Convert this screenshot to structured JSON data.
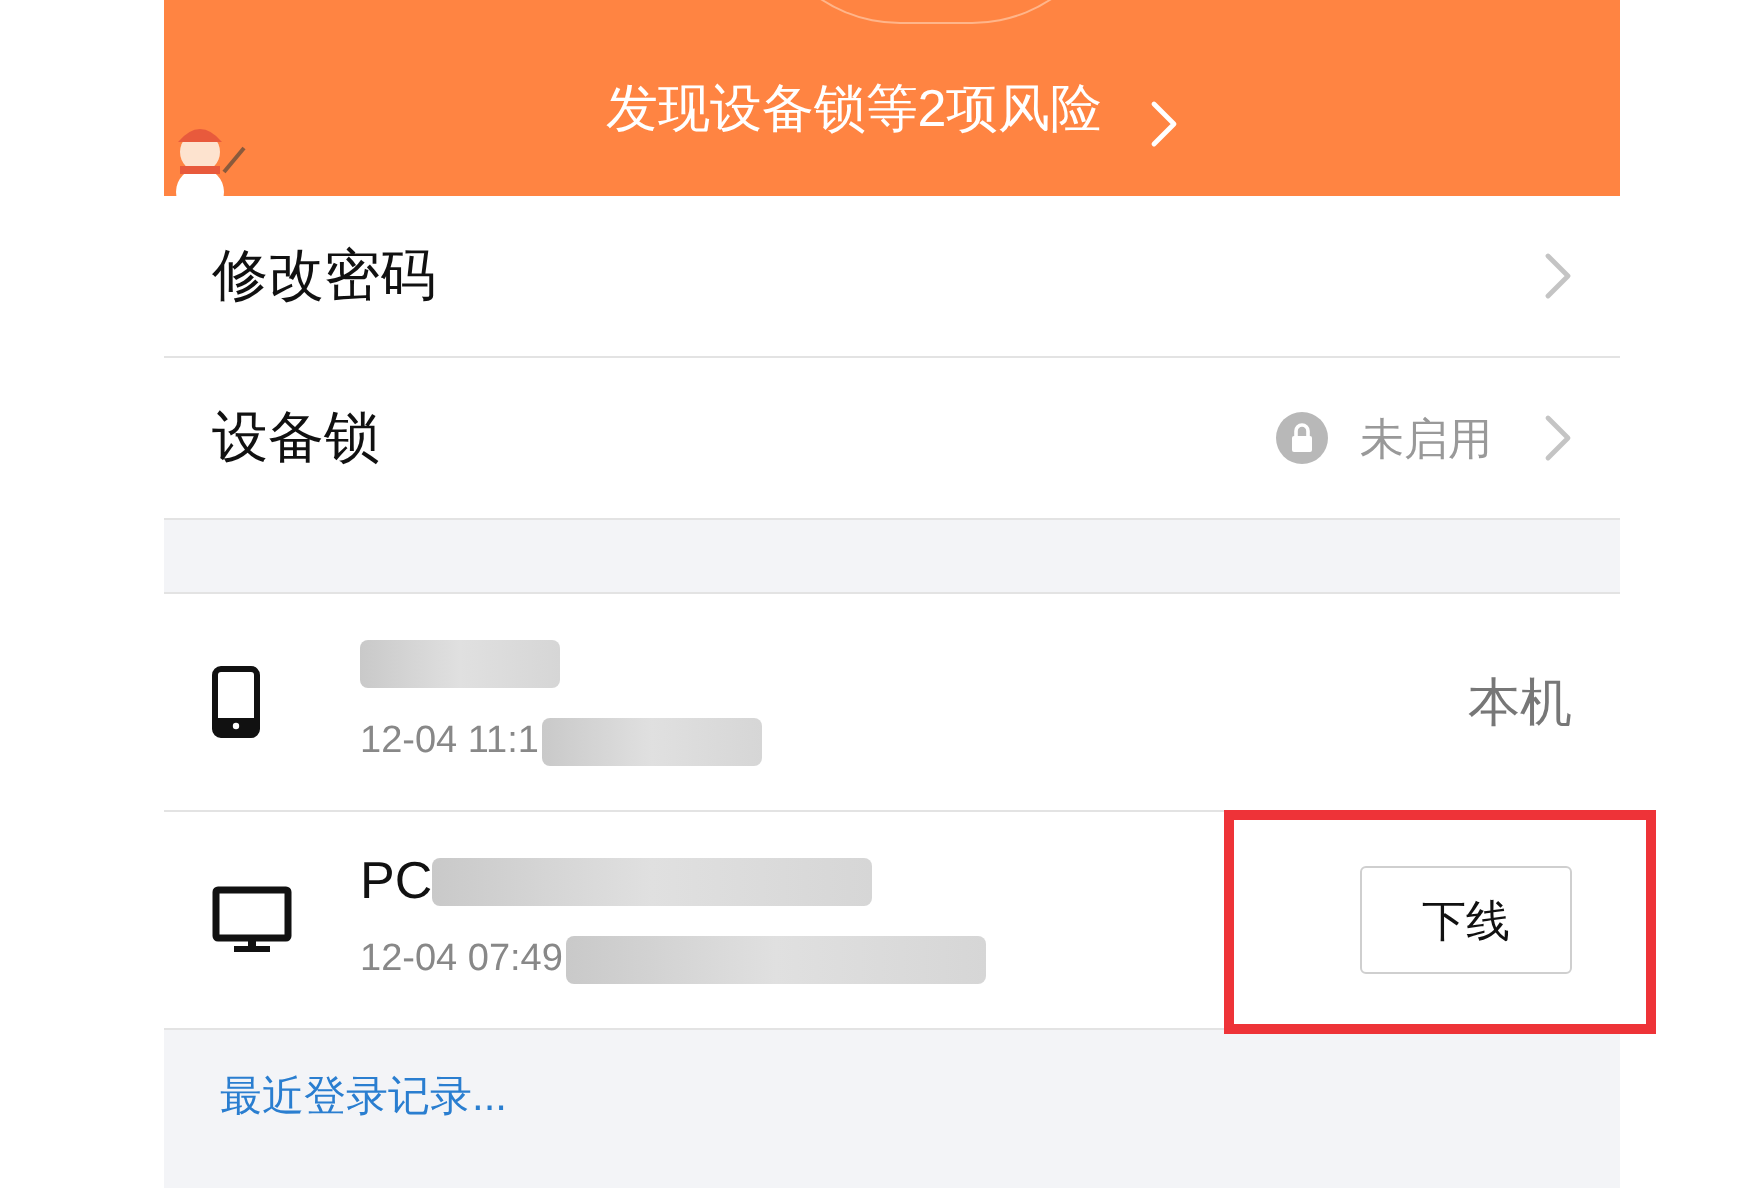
{
  "banner": {
    "text": "发现设备锁等2项风险"
  },
  "settings": [
    {
      "kind": "link",
      "label": "修改密码"
    },
    {
      "kind": "status",
      "label": "设备锁",
      "status": "未启用"
    }
  ],
  "devices": [
    {
      "kind": "phone",
      "time": "12-04 11:1",
      "current": "本机"
    },
    {
      "kind": "pc",
      "name": "PC",
      "time": "12-04 07:49",
      "action": "下线"
    }
  ],
  "footer_link": "最近登录记录..."
}
